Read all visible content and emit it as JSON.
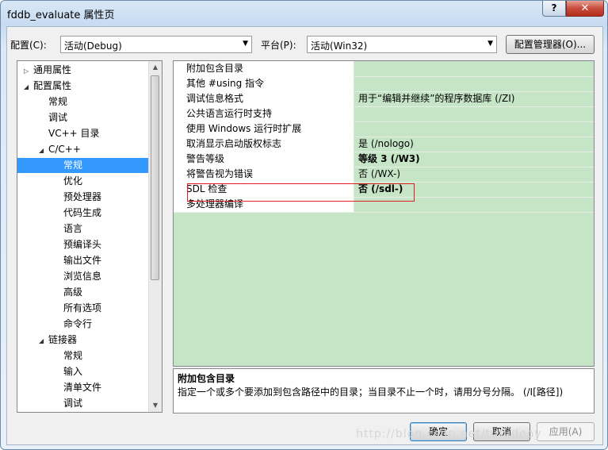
{
  "window": {
    "title": "fddb_evaluate 属性页",
    "help_label": "?",
    "close_label": "✕"
  },
  "toolbar": {
    "config_label": "配置(C):",
    "config_value": "活动(Debug)",
    "platform_label": "平台(P):",
    "platform_value": "活动(Win32)",
    "config_manager_label": "配置管理器(O)..."
  },
  "tree": {
    "items": [
      {
        "label": "通用属性",
        "expander": "▷",
        "selected": false
      },
      {
        "label": "配置属性",
        "expander": "◢",
        "selected": false
      },
      {
        "label": "常规",
        "expander": "",
        "selected": false
      },
      {
        "label": "调试",
        "expander": "",
        "selected": false
      },
      {
        "label": "VC++ 目录",
        "expander": "",
        "selected": false
      },
      {
        "label": "C/C++",
        "expander": "◢",
        "selected": false
      },
      {
        "label": "常规",
        "expander": "",
        "selected": true
      },
      {
        "label": "优化",
        "expander": "",
        "selected": false
      },
      {
        "label": "预处理器",
        "expander": "",
        "selected": false
      },
      {
        "label": "代码生成",
        "expander": "",
        "selected": false
      },
      {
        "label": "语言",
        "expander": "",
        "selected": false
      },
      {
        "label": "预编译头",
        "expander": "",
        "selected": false
      },
      {
        "label": "输出文件",
        "expander": "",
        "selected": false
      },
      {
        "label": "浏览信息",
        "expander": "",
        "selected": false
      },
      {
        "label": "高级",
        "expander": "",
        "selected": false
      },
      {
        "label": "所有选项",
        "expander": "",
        "selected": false
      },
      {
        "label": "命令行",
        "expander": "",
        "selected": false
      },
      {
        "label": "链接器",
        "expander": "◢",
        "selected": false
      },
      {
        "label": "常规",
        "expander": "",
        "selected": false
      },
      {
        "label": "输入",
        "expander": "",
        "selected": false
      },
      {
        "label": "清单文件",
        "expander": "",
        "selected": false
      },
      {
        "label": "调试",
        "expander": "",
        "selected": false
      }
    ]
  },
  "properties": [
    {
      "name": "附加包含目录",
      "value": "",
      "bold": false
    },
    {
      "name": "其他 #using 指令",
      "value": "",
      "bold": false
    },
    {
      "name": "调试信息格式",
      "value": "用于“编辑并继续”的程序数据库 (/ZI)",
      "bold": false
    },
    {
      "name": "公共语言运行时支持",
      "value": "",
      "bold": false
    },
    {
      "name": "使用 Windows 运行时扩展",
      "value": "",
      "bold": false
    },
    {
      "name": "取消显示启动版权标志",
      "value": "是 (/nologo)",
      "bold": false
    },
    {
      "name": "警告等级",
      "value": "等级 3 (/W3)",
      "bold": true
    },
    {
      "name": "将警告视为错误",
      "value": "否 (/WX-)",
      "bold": false
    },
    {
      "name": "SDL 检查",
      "value": "否 (/sdl-)",
      "bold": true
    },
    {
      "name": "多处理器编译",
      "value": "",
      "bold": false
    }
  ],
  "description": {
    "title": "附加包含目录",
    "text": "指定一个或多个要添加到包含路径中的目录；当目录不止一个时，请用分号分隔。           (/I[路径])"
  },
  "buttons": {
    "ok": "确定",
    "cancel": "取消",
    "apply": "应用(A)"
  },
  "watermark": "http://blog.csdn.net/tutudooy",
  "colors": {
    "grid_bg": "#c6e5c6",
    "selection": "#3399ff",
    "highlight_box": "#e02020"
  }
}
